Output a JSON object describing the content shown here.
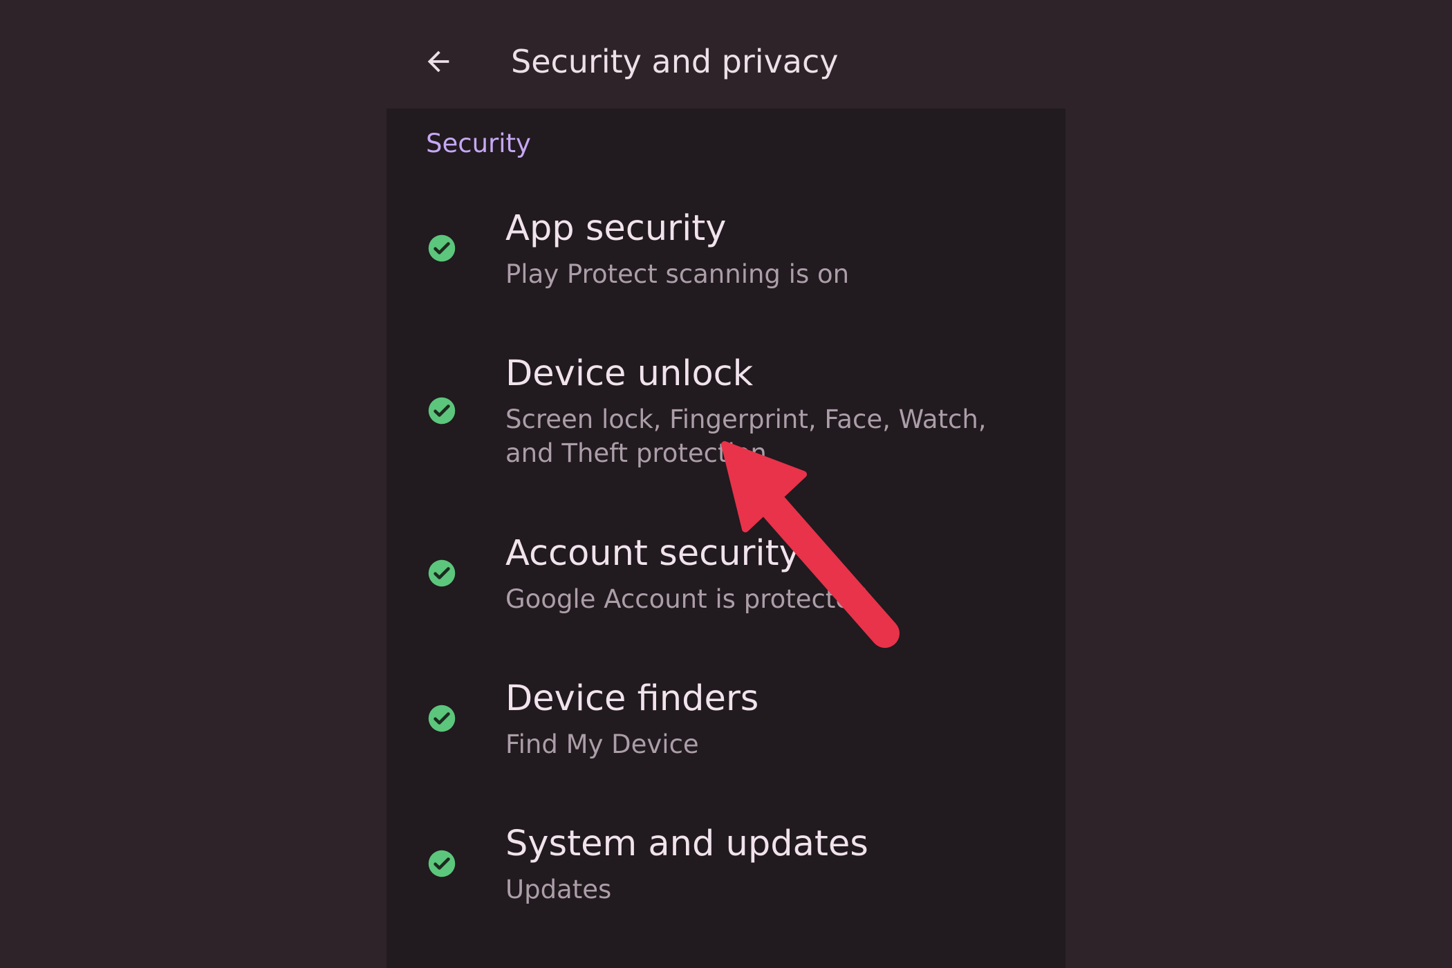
{
  "app_bar": {
    "back_icon": "arrow-left-icon",
    "title": "Security and privacy"
  },
  "section": {
    "header": "Security"
  },
  "items": [
    {
      "title": "App security",
      "subtitle": "Play Protect scanning is on",
      "status": "ok",
      "icon": "check-circle-icon"
    },
    {
      "title": "Device unlock",
      "subtitle": "Screen lock, Fingerprint, Face, Watch, and Theft protection",
      "status": "ok",
      "icon": "check-circle-icon"
    },
    {
      "title": "Account security",
      "subtitle": "Google Account is protected",
      "status": "ok",
      "icon": "check-circle-icon"
    },
    {
      "title": "Device finders",
      "subtitle": "Find My Device",
      "status": "ok",
      "icon": "check-circle-icon"
    },
    {
      "title": "System and updates",
      "subtitle": "Updates",
      "status": "ok",
      "icon": "check-circle-icon"
    }
  ],
  "colors": {
    "background": "#2e2329",
    "panel": "#211a1f",
    "accent": "#c6a8f5",
    "check": "#5cc67c",
    "annotation_arrow": "#e8334a"
  }
}
